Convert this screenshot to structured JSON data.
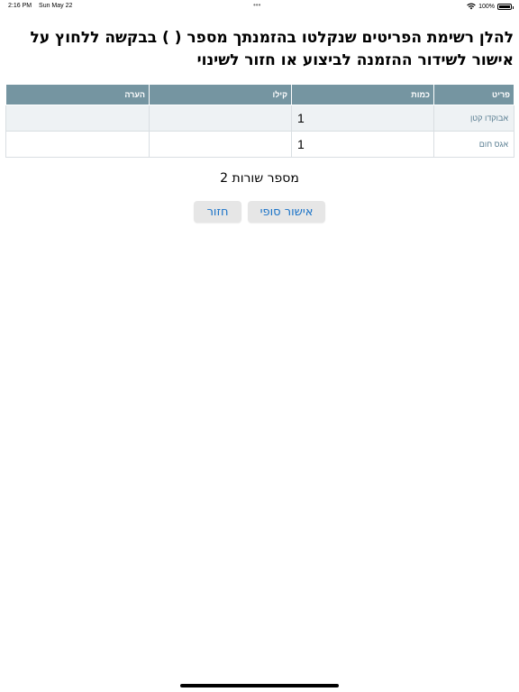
{
  "status_bar": {
    "time": "2:16 PM",
    "date": "Sun May 22",
    "dots": "•••",
    "battery_text": "100%",
    "battery_level": 1.0
  },
  "heading": "להלן רשימת הפריטים שנקלטו בהזמנתך מספר ( ) בבקשה ללחוץ על אישור לשידור ההזמנה לביצוע או חזור לשינוי",
  "table": {
    "headers": {
      "item": "פריט",
      "qty": "כמות",
      "kilo": "קילו",
      "note": "הערה"
    },
    "rows": [
      {
        "item": "אבוקדו קטן",
        "qty": "1",
        "kilo": "",
        "note": ""
      },
      {
        "item": "אגס חום",
        "qty": "1",
        "kilo": "",
        "note": ""
      }
    ]
  },
  "row_count_text": "מספר שורות 2",
  "buttons": {
    "confirm": "אישור סופי",
    "back": "חזור"
  },
  "colors": {
    "table_header_bg": "#7595a1",
    "item_text": "#5a7e92",
    "button_text": "#1a73c8",
    "button_bg": "#e6e6e6"
  }
}
